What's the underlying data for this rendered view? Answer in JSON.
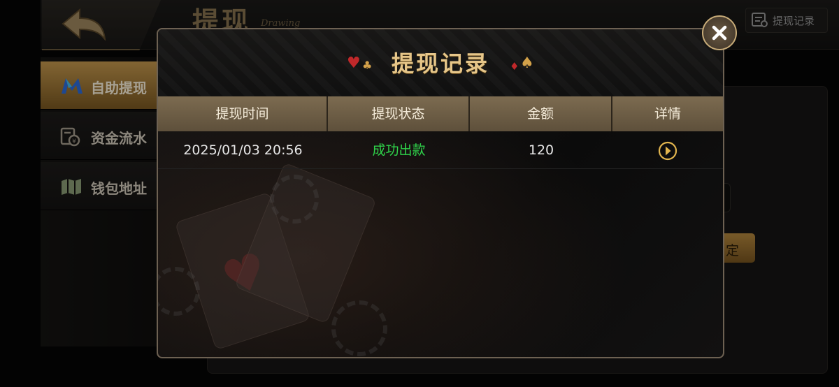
{
  "header": {
    "title": "提现",
    "subtitle": "Drawing",
    "records_button": "提现记录"
  },
  "sidebar": {
    "items": [
      {
        "label": "自助提现",
        "icon": "m-logo-icon",
        "active": true
      },
      {
        "label": "资金流水",
        "icon": "ledger-icon",
        "active": false
      },
      {
        "label": "钱包地址",
        "icon": "map-icon",
        "active": false
      }
    ]
  },
  "background_form": {
    "confirm_label": "定"
  },
  "modal": {
    "title": "提现记录",
    "columns": [
      "提现时间",
      "提现状态",
      "金额",
      "详情"
    ],
    "rows": [
      {
        "time": "2025/01/03 20:56",
        "status": "成功出款",
        "amount": "120"
      }
    ]
  },
  "colors": {
    "accent_gold": "#e6c689",
    "status_success": "#2fd34a",
    "header_bg": "#7c6b50",
    "suit_red": "#c0282a",
    "suit_gold": "#d4a24a"
  },
  "icons": {
    "back": "back-arrow-icon",
    "records": "document-icon",
    "close": "close-icon",
    "detail": "chevron-right-circle-icon",
    "suits": [
      "heart-icon",
      "club-icon",
      "diamond-icon",
      "spade-icon"
    ]
  }
}
